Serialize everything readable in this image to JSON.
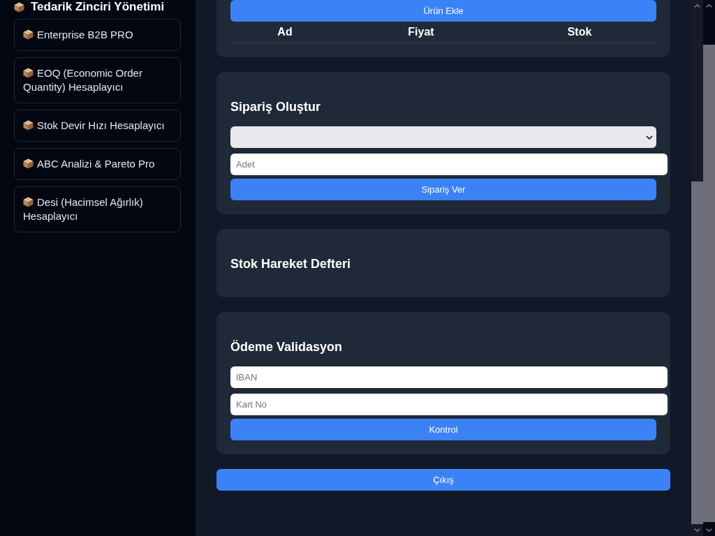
{
  "sidebar": {
    "title": "Tedarik Zinciri Yönetimi",
    "items": [
      {
        "label": "Enterprise B2B PRO",
        "selected": false
      },
      {
        "label": "EOQ (Economic Order Quantity) Hesaplayıcı",
        "selected": false
      },
      {
        "label": "Stok Devir Hızı Hesaplayıcı",
        "selected": false
      },
      {
        "label": "ABC Analizi & Pareto Pro",
        "selected": false
      },
      {
        "label": "Desi (Hacimsel Ağırlık) Hesaplayıcı",
        "selected": false
      }
    ]
  },
  "main": {
    "sections": [
      {
        "blocks": [
          {
            "kind": "button",
            "label": "Ürün Ekle"
          },
          {
            "kind": "table",
            "columns": [
              "Ad",
              "Fiyat",
              "Stok"
            ]
          }
        ]
      },
      {
        "title": "Sipariş Oluştur",
        "blocks": [
          {
            "kind": "select"
          },
          {
            "kind": "input",
            "placeholder": "Adet"
          },
          {
            "kind": "button",
            "label": "Sipariş Ver"
          }
        ]
      },
      {
        "title": "Stok Hareket Defteri"
      },
      {
        "title": "Ödeme Validasyon",
        "blocks": [
          {
            "kind": "input",
            "placeholder": "IBAN"
          },
          {
            "kind": "input",
            "placeholder": "Kart No"
          },
          {
            "kind": "button",
            "label": "Kontrol"
          }
        ]
      }
    ],
    "logout_button": "Çıkış"
  }
}
